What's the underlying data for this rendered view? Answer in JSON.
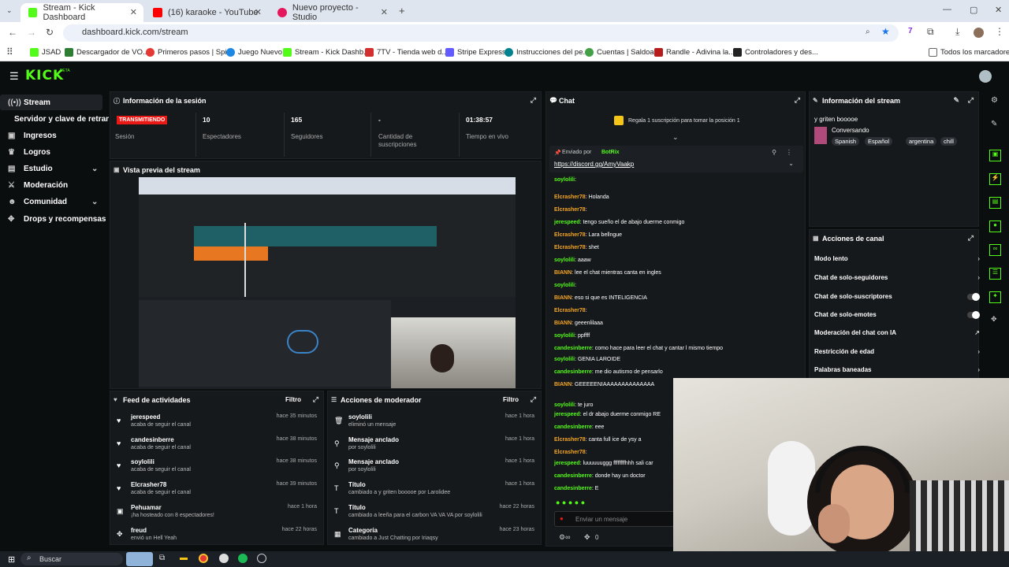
{
  "browser": {
    "tabs": [
      {
        "label": "Stream - Kick Dashboard",
        "fav": "#53fc18"
      },
      {
        "label": "(16) karaoke - YouTube",
        "fav": "#ff0000"
      },
      {
        "label": "Nuevo proyecto - Studio",
        "fav": "#e4175c"
      }
    ],
    "url": "dashboard.kick.com/stream"
  },
  "bookmarks": [
    "JSAD",
    "Descargador de VO...",
    "Primeros pasos | Spi...",
    "Juego Nuevo",
    "Stream - Kick Dashb...",
    "7TV - Tienda web d...",
    "Stripe Express",
    "Instrucciones del pe...",
    "Cuentas | Saldoar",
    "Randle - Adivina la...",
    "Controladores y des...",
    "Todos los marcadores"
  ],
  "kick": {
    "logo": "KICK",
    "beta": "BETA"
  },
  "sidebar": {
    "items": [
      {
        "label": "Stream",
        "icon": "broadcast-icon",
        "active": true
      },
      {
        "label": "Servidor y clave de retransmisión",
        "icon": ""
      },
      {
        "label": "Ingresos",
        "icon": "money-icon"
      },
      {
        "label": "Logros",
        "icon": "trophy-icon"
      },
      {
        "label": "Estudio",
        "icon": "studio-icon",
        "caret": true
      },
      {
        "label": "Moderación",
        "icon": "sword-icon"
      },
      {
        "label": "Comunidad",
        "icon": "users-icon",
        "caret": true
      },
      {
        "label": "Drops y recompensas",
        "icon": "gift-icon"
      }
    ]
  },
  "session": {
    "title": "Información de la sesión",
    "status": "TRANSMITIENDO",
    "status_label": "Sesión",
    "spectators": "10",
    "spectators_label": "Espectadores",
    "followers": "165",
    "followers_label": "Seguidores",
    "subs": "-",
    "subs_label": "Cantidad de suscripciones",
    "time": "01:38:57",
    "time_label": "Tiempo en vivo"
  },
  "preview": {
    "title": "Vista previa del stream"
  },
  "feed": {
    "title": "Feed de actividades",
    "filter": "Filtro",
    "items": [
      {
        "name": "jerespeed",
        "desc": "acaba de seguir el canal",
        "time": "hace 35 minutos"
      },
      {
        "name": "candesinberre",
        "desc": "acaba de seguir el canal",
        "time": "hace 38 minutos"
      },
      {
        "name": "soylolili",
        "desc": "acaba de seguir el canal",
        "time": "hace 38 minutos"
      },
      {
        "name": "Elcrasher78",
        "desc": "acaba de seguir el canal",
        "time": "hace 39 minutos"
      },
      {
        "name": "Pehuamar",
        "desc": "¡ha hosteado con 8 espectadores!",
        "time": "hace 1 hora"
      },
      {
        "name": "freud",
        "desc": "envió un Hell Yeah",
        "time": "hace 22 horas"
      }
    ]
  },
  "modactions": {
    "title": "Acciones de moderador",
    "filter": "Filtro",
    "items": [
      {
        "name": "soylolili",
        "desc": "eliminó un mensaje",
        "time": "hace 1 hora"
      },
      {
        "name": "Mensaje anclado",
        "desc": "por soylolili",
        "time": "hace 1 hora"
      },
      {
        "name": "Mensaje anclado",
        "desc": "por soylolili",
        "time": "hace 1 hora"
      },
      {
        "name": "Título",
        "desc": "cambiado a y griten booooe por Larolidee",
        "time": "hace 1 hora"
      },
      {
        "name": "Título",
        "desc": "cambiado a leeña para el carbon VA VA VA por soylolili",
        "time": "hace 22 horas"
      },
      {
        "name": "Categoría",
        "desc": "cambiado a Just Chatting por Iriaqsy",
        "time": "hace 23 horas"
      }
    ]
  },
  "chat": {
    "title": "Chat",
    "banner": "Regala 1 suscripción para tomar la posición 1",
    "pinned_by": "Enviado por",
    "pinned_user": "BotRix",
    "pinned_link": "https://discord.gg/AmyVaakp",
    "placeholder": "Enviar un mensaje",
    "counter": "0",
    "messages": [
      {
        "u": "soylolili",
        "t": ":",
        "c": "#53fc18"
      },
      {
        "u": "Elcrasher78",
        "t": ": Holanda",
        "c": "#f5a623"
      },
      {
        "u": "Elcrasher78",
        "t": ":",
        "c": "#f5a623"
      },
      {
        "u": "jerespeed",
        "t": ": tengo sueño el de abajo duerme conmigo",
        "c": "#53fc18"
      },
      {
        "u": "Elcrasher78",
        "t": ": Lara bellngue",
        "c": "#f5a623"
      },
      {
        "u": "Elcrasher78",
        "t": ": shet",
        "c": "#f5a623"
      },
      {
        "u": "soylolili",
        "t": ": aaaw",
        "c": "#53fc18"
      },
      {
        "u": "BIANN",
        "t": ": lee el chat mientras canta en ingles",
        "c": "#f5a623"
      },
      {
        "u": "soylolili",
        "t": ":",
        "c": "#53fc18"
      },
      {
        "u": "BIANN",
        "t": ": eso si que es INTELIGENCIA",
        "c": "#f5a623"
      },
      {
        "u": "Elcrasher78",
        "t": ":",
        "c": "#f5a623"
      },
      {
        "u": "BIANN",
        "t": ": geeenlilaaa",
        "c": "#f5a623"
      },
      {
        "u": "soylolili",
        "t": ": ppffff",
        "c": "#53fc18"
      },
      {
        "u": "candesinberre",
        "t": ": como hace para leer el chat y cantar l mismo tiempo",
        "c": "#53fc18"
      },
      {
        "u": "soylolili",
        "t": ": GENIA LAROIDE",
        "c": "#53fc18"
      },
      {
        "u": "candesinberre",
        "t": ": me dio autismo de pensarlo",
        "c": "#53fc18"
      },
      {
        "u": "BIANN",
        "t": ": GEEEEENIAAAAAAAAAAAAAA",
        "c": "#f5a623"
      },
      {
        "u": "soylolili",
        "t": ": te juro",
        "c": "#53fc18"
      },
      {
        "u": "jerespeed",
        "t": ": el dr abajo duerme conmigo RE",
        "c": "#53fc18"
      },
      {
        "u": "candesinberre",
        "t": ": eee",
        "c": "#53fc18"
      },
      {
        "u": "Elcrasher78",
        "t": ": canta full ice de ysy a",
        "c": "#f5a623"
      },
      {
        "u": "Elcrasher78",
        "t": ":",
        "c": "#f5a623"
      },
      {
        "u": "jerespeed",
        "t": ": luuuuuuggg ffffffffhhh sali car",
        "c": "#53fc18"
      },
      {
        "u": "candesinberre",
        "t": ": donde hay un doctor",
        "c": "#53fc18"
      },
      {
        "u": "candesinberre",
        "t": ": E",
        "c": "#53fc18"
      }
    ]
  },
  "streaminfo": {
    "title": "Información del stream",
    "stream_title": "y griten booooe",
    "category": "Conversando",
    "tags": [
      "Spanish",
      "Español",
      "argentina",
      "chill"
    ]
  },
  "channel": {
    "title": "Acciones de canal",
    "items": [
      {
        "label": "Modo lento",
        "kind": "arrow"
      },
      {
        "label": "Chat de solo-seguidores",
        "kind": "arrow"
      },
      {
        "label": "Chat de solo-suscriptores",
        "kind": "toggle"
      },
      {
        "label": "Chat de solo-emotes",
        "kind": "toggle"
      },
      {
        "label": "Moderación del chat con IA",
        "kind": "link"
      },
      {
        "label": "Restricción de edad",
        "kind": "arrow"
      },
      {
        "label": "Palabras baneadas",
        "kind": "arrow"
      }
    ]
  },
  "taskbar": {
    "search": "Buscar"
  },
  "colors": {
    "kick_green": "#53fc18",
    "live_red": "#e91916"
  }
}
